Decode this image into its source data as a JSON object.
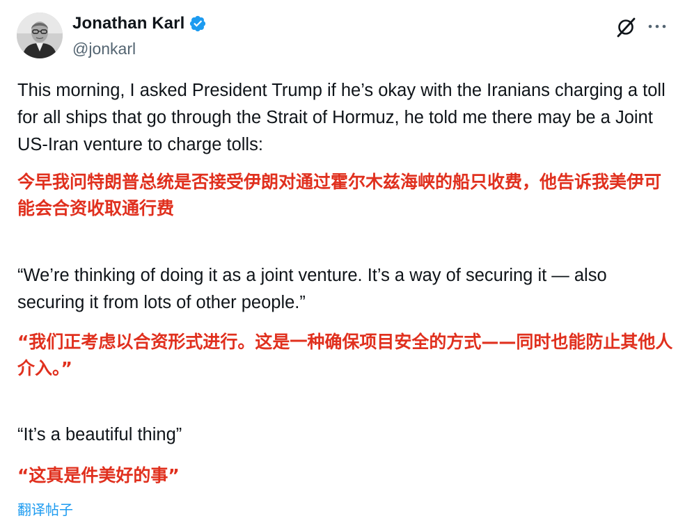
{
  "author": {
    "display_name": "Jonathan Karl",
    "handle": "@jonkarl",
    "verified": true,
    "verified_color": "#1d9bf0"
  },
  "actions": {
    "grok_icon": "grok-slash-icon",
    "more_icon": "more-dots-icon"
  },
  "post": {
    "paragraph1_en": "This morning, I asked President Trump if he’s okay with the Iranians charging a toll for all ships that go through the Strait of Hormuz, he told me there may be a Joint US-Iran venture to charge tolls:",
    "paragraph1_zh": "今早我问特朗普总统是否接受伊朗对通过霍尔木兹海峡的船只收费，他告诉我美伊可能会合资收取通行费",
    "paragraph2_en": "“We’re thinking of doing it as a joint venture. It’s a way of securing it — also securing it from lots of other people.”",
    "paragraph2_zh": "“我们正考虑以合资形式进行。这是一种确保项目安全的方式——同时也能防止其他人介入。”",
    "paragraph3_en": "“It’s a beautiful thing”",
    "paragraph3_zh": "“这真是件美好的事”"
  },
  "translate_link": "翻译帖子",
  "colors": {
    "text": "#0f1419",
    "secondary": "#536471",
    "annotation_red": "#e0301e",
    "link": "#1d9bf0"
  }
}
